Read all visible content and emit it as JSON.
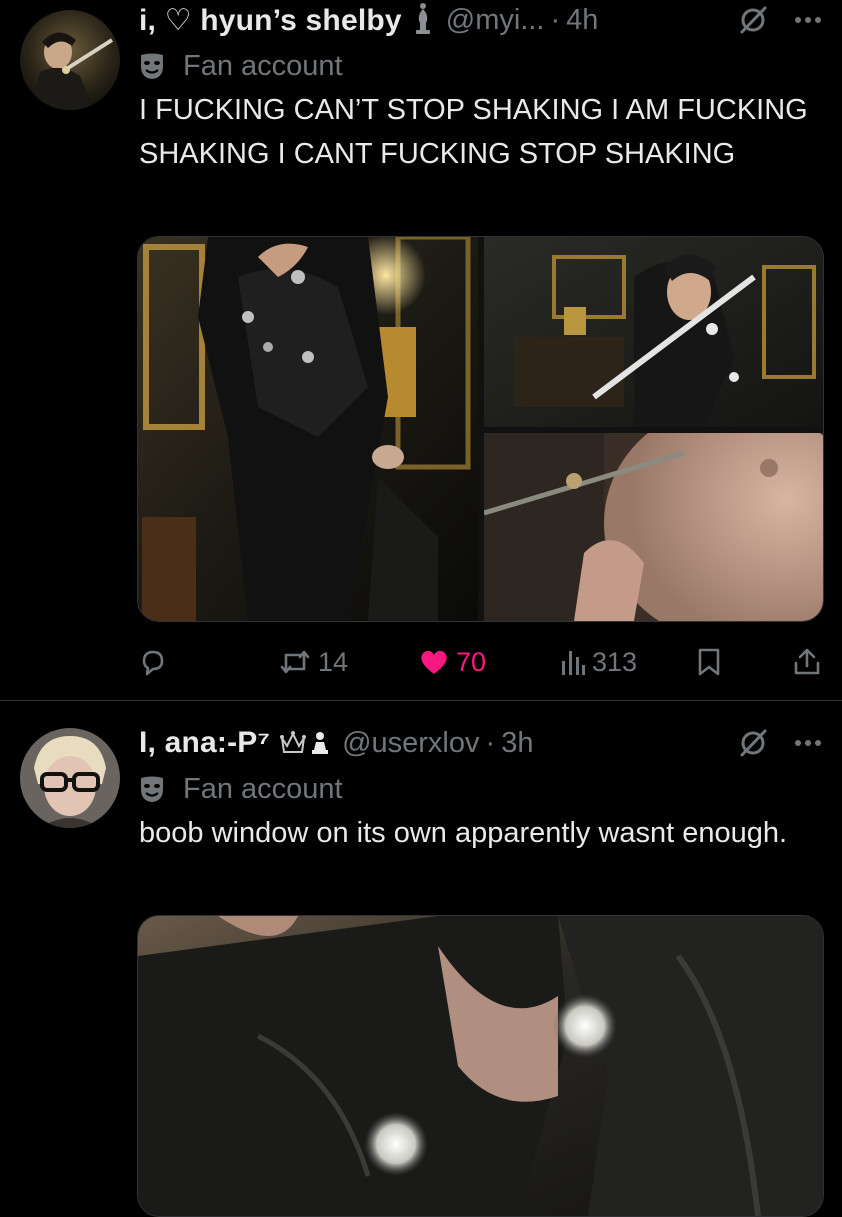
{
  "tweets": [
    {
      "display_name": "i, ♡ hyun’s shelby",
      "handle": "@myi...",
      "separator": "·",
      "time": "4h",
      "label": "Fan account",
      "text": "I FUCKING CAN’T STOP SHAKING I AM FUCKING SHAKING I CANT FUCKING STOP SHAKING",
      "badges": [
        "chess-bishop-icon"
      ],
      "media_count": 3,
      "actions": {
        "replies": "",
        "reposts": "14",
        "likes": "70",
        "liked": true,
        "views": "313"
      }
    },
    {
      "display_name": "I, ana:-P⁷",
      "handle": "@userxlov",
      "separator": "·",
      "time": "3h",
      "label": "Fan account",
      "text": "boob window on its own apparently wasnt enough.",
      "badges": [
        "crown-icon",
        "chess-pawn-icon"
      ],
      "media_count": 1
    }
  ],
  "colors": {
    "background": "#000000",
    "text_primary": "#e7e9ea",
    "text_secondary": "#71767b",
    "like_pink": "#f91880",
    "divider": "#2f3336"
  }
}
